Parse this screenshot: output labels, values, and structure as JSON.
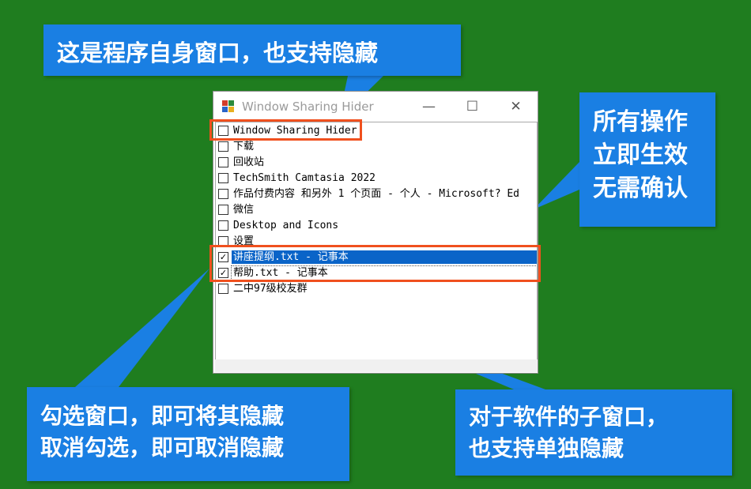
{
  "callouts": {
    "top": "这是程序自身窗口，也支持隐藏",
    "right": [
      "所有操作",
      "立即生效",
      "无需确认"
    ],
    "bottom_left": [
      "勾选窗口，即可将其隐藏",
      "取消勾选，即可取消隐藏"
    ],
    "bottom_right": [
      "对于软件的子窗口，",
      "也支持单独隐藏"
    ]
  },
  "window": {
    "title": "Window Sharing Hider",
    "controls": {
      "minimize": "—",
      "maximize": "☐",
      "close": "✕"
    },
    "items": [
      {
        "label": "Window Sharing Hider",
        "checked": false
      },
      {
        "label": "下载",
        "checked": false
      },
      {
        "label": "回收站",
        "checked": false
      },
      {
        "label": "TechSmith Camtasia 2022",
        "checked": false
      },
      {
        "label": "作品付费内容 和另外 1 个页面 - 个人 - Microsoft? Ed",
        "checked": false
      },
      {
        "label": "微信",
        "checked": false
      },
      {
        "label": "Desktop and Icons",
        "checked": false
      },
      {
        "label": "设置",
        "checked": false
      },
      {
        "label": "讲座提纲.txt - 记事本",
        "checked": true
      },
      {
        "label": "帮助.txt - 记事本",
        "checked": true
      },
      {
        "label": "二中97级校友群",
        "checked": false
      }
    ],
    "check_mark": "✓"
  },
  "colors": {
    "background": "#1f7d1f",
    "callout": "#1a7fe3",
    "highlight": "#f0501e",
    "selection": "#0a64c8"
  }
}
